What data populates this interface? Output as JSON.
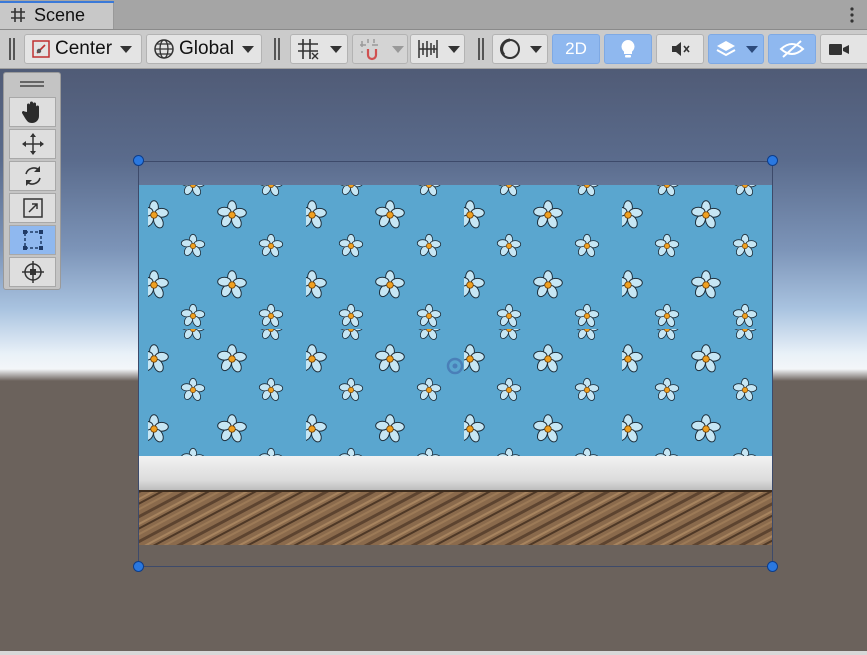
{
  "tab": {
    "label": "Scene"
  },
  "toolbar": {
    "pivot_mode": "Center",
    "pivot_rotation": "Global",
    "mode_2d": "2D"
  },
  "tools": [
    "hand-tool",
    "move-tool",
    "rotate-tool",
    "scale-tool",
    "rect-tool",
    "transform-tool"
  ],
  "active_tool": "rect-tool",
  "colors": {
    "accent": "#3a79d8",
    "toggle_active": "#8fb8ef",
    "wallpaper": "#5aa6cf",
    "flower_petal": "#b9dff0",
    "flower_center": "#f0a020",
    "handle": "#2a78e0"
  },
  "icons": [
    "grid-icon",
    "kebab-icon",
    "pivot-icon",
    "globe-icon",
    "grid-snap-icon",
    "magnet-icon",
    "ruler-icon",
    "sphere-icon",
    "lightbulb-icon",
    "audio-mute-icon",
    "layers-icon",
    "visibility-off-icon",
    "camera-icon"
  ]
}
